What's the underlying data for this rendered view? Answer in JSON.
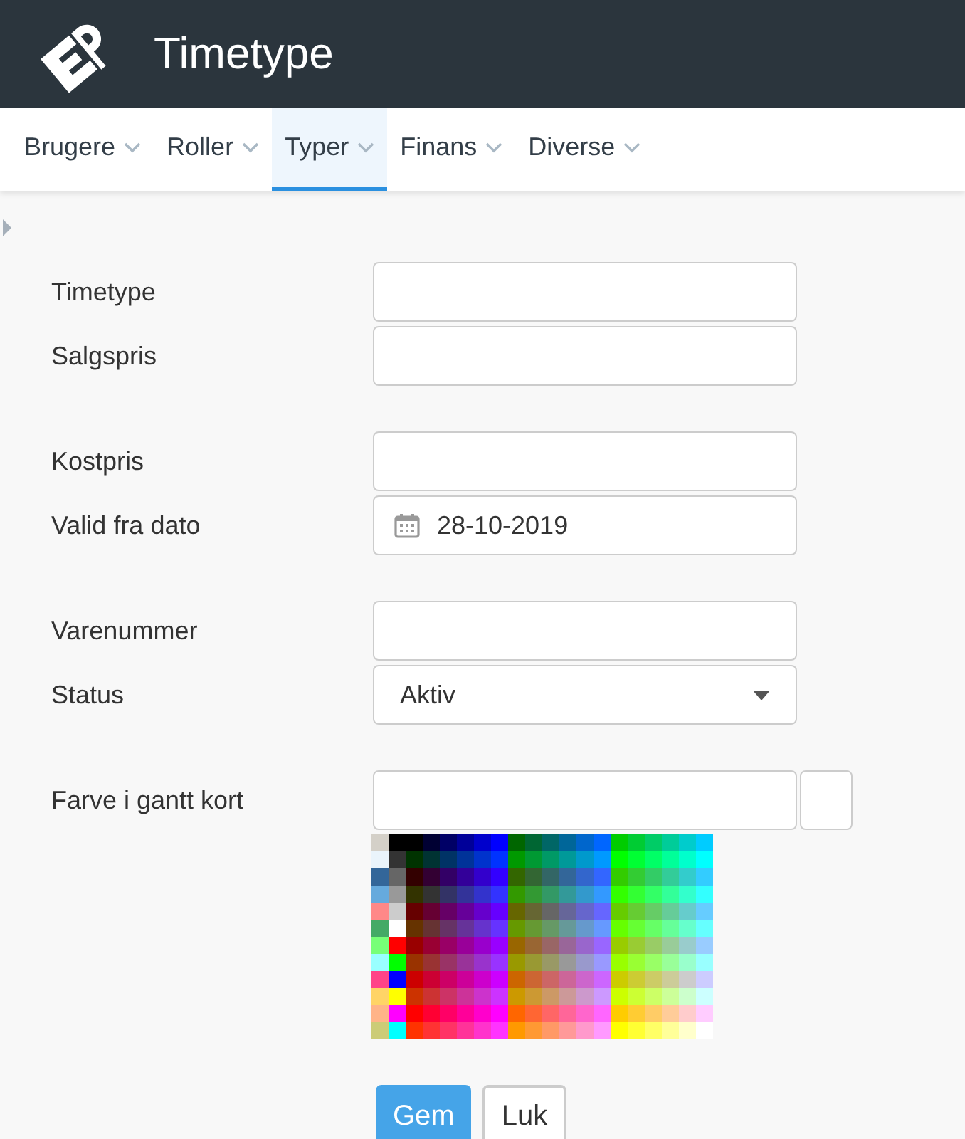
{
  "header": {
    "title": "Timetype"
  },
  "nav": [
    {
      "label": "Brugere",
      "selected": false
    },
    {
      "label": "Roller",
      "selected": false
    },
    {
      "label": "Typer",
      "selected": true
    },
    {
      "label": "Finans",
      "selected": false
    },
    {
      "label": "Diverse",
      "selected": false
    }
  ],
  "form": {
    "groups": [
      [
        {
          "label": "Timetype",
          "kind": "text"
        },
        {
          "label": "Salgspris",
          "kind": "text"
        }
      ],
      [
        {
          "label": "Kostpris",
          "kind": "text"
        },
        {
          "label": "Valid fra dato",
          "kind": "date",
          "value": "28-10-2019"
        }
      ],
      [
        {
          "label": "Varenummer",
          "kind": "text"
        },
        {
          "label": "Status",
          "kind": "select",
          "value": "Aktiv"
        }
      ],
      [
        {
          "label": "Farve i gantt kort",
          "kind": "color"
        }
      ]
    ]
  },
  "buttons": [
    {
      "label": "Gem",
      "kind": "primary"
    },
    {
      "label": "Luk",
      "kind": "secondary"
    }
  ]
}
